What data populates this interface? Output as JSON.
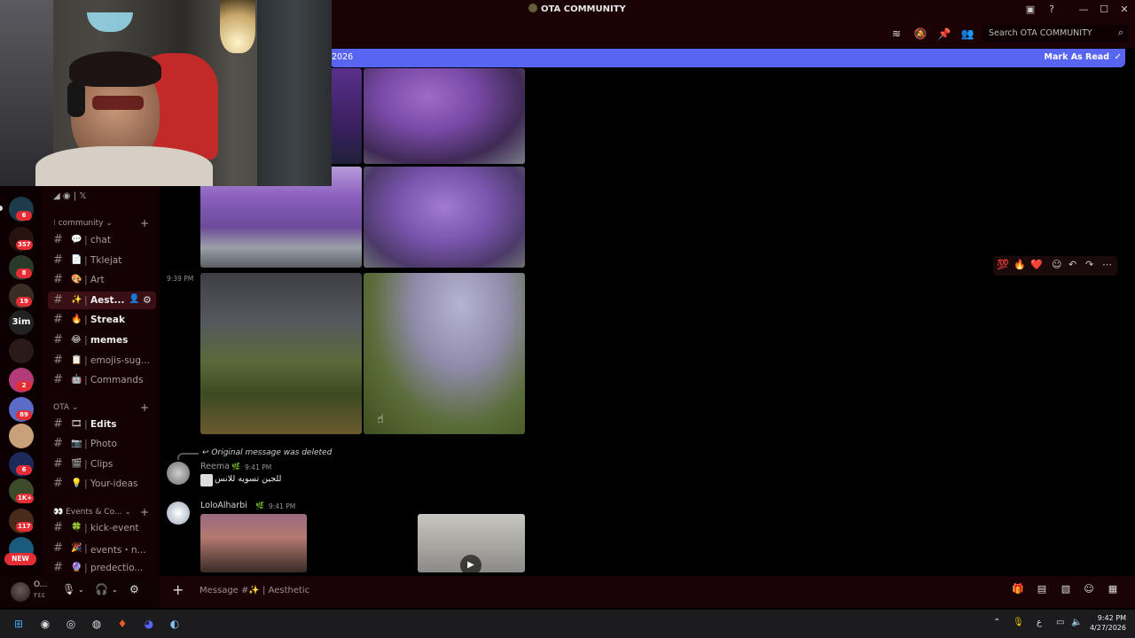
{
  "window": {
    "title": "OTA COMMUNITY",
    "controls": [
      "minimize",
      "maximize",
      "close"
    ]
  },
  "header": {
    "search_placeholder": "Search OTA COMMUNITY",
    "icons": [
      "threads-icon",
      "mute-icon",
      "pin-icon",
      "members-icon"
    ]
  },
  "banner": {
    "date_fragment": "2026",
    "mark_label": "Mark As Read"
  },
  "servers": {
    "badges": [
      "6",
      "357",
      "8",
      "19",
      "2",
      "89",
      "6",
      "1K+",
      "117"
    ],
    "new_label": "NEW"
  },
  "channels": {
    "categories": [
      {
        "label": "community"
      },
      {
        "label": "OTA"
      },
      {
        "label": "Events & Co..."
      }
    ],
    "items": [
      {
        "emoji": "💬",
        "name": "chat",
        "bold": false,
        "active": false
      },
      {
        "emoji": "📄",
        "name": "Tklejat",
        "bold": false,
        "active": false
      },
      {
        "emoji": "🎨",
        "name": "Art",
        "bold": false,
        "active": false
      },
      {
        "emoji": "✨",
        "name": "Aest...",
        "bold": true,
        "active": true
      },
      {
        "emoji": "🔥",
        "name": "Streak",
        "bold": true,
        "active": false
      },
      {
        "emoji": "😂",
        "name": "memes",
        "bold": true,
        "active": false
      },
      {
        "emoji": "📋",
        "name": "emojis-sug...",
        "bold": false,
        "active": false
      },
      {
        "emoji": "🤖",
        "name": "Commands",
        "bold": false,
        "active": false
      },
      {
        "emoji": "🎞",
        "name": "Edits",
        "bold": true,
        "active": false
      },
      {
        "emoji": "📷",
        "name": "Photo",
        "bold": false,
        "active": false
      },
      {
        "emoji": "🎬",
        "name": "Clips",
        "bold": false,
        "active": false
      },
      {
        "emoji": "💡",
        "name": "Your-ideas",
        "bold": false,
        "active": false
      },
      {
        "emoji": "🍀",
        "name": "kick-event",
        "bold": false,
        "active": false
      },
      {
        "emoji": "🎉",
        "name": "events・n...",
        "bold": false,
        "active": false
      },
      {
        "emoji": "🔮",
        "name": "predectio...",
        "bold": false,
        "active": false
      }
    ],
    "top_row_label": "𝕏"
  },
  "user": {
    "name": "O...",
    "status": "٢٤٤"
  },
  "chat": {
    "gutter_time": "9:39 PM",
    "deleted_label": "Original message was deleted",
    "messages": [
      {
        "author": "Reema",
        "time": "9:41 PM",
        "text": "للجين تسويه للانس",
        "author_color": "#9b9b9b"
      },
      {
        "author": "LoloAlharbi",
        "time": "9:41 PM",
        "text": "",
        "author_color": "#d6d6d6"
      }
    ],
    "hover_reactions": [
      "💯",
      "🔥",
      "❤️"
    ]
  },
  "composer": {
    "placeholder": "Message #✨ | Aesthetic"
  },
  "taskbar": {
    "time": "9:42 PM",
    "date": "4/27/2026",
    "lang": "ع"
  },
  "colors": {
    "accent": "#5865f2",
    "badge": "#e52d35",
    "sidebar": "#140104",
    "active_channel": "#3a1015"
  }
}
